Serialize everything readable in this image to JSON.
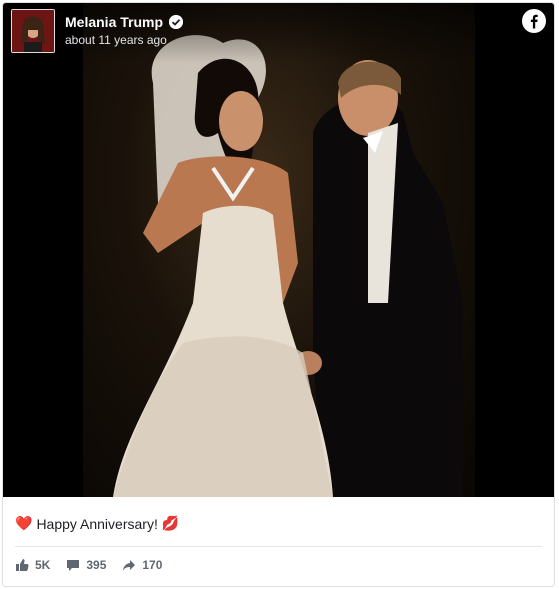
{
  "post": {
    "author": "Melania Trump",
    "timestamp": "about 11 years ago",
    "caption": "Happy Anniversary!",
    "caption_prefix_emoji": "❤️",
    "caption_suffix_emoji": "💋"
  },
  "stats": {
    "likes": "5K",
    "comments": "395",
    "shares": "170"
  },
  "icons": {
    "like": "thumbs-up-icon",
    "comment": "comment-icon",
    "share": "share-icon",
    "verified": "verified-badge-icon",
    "brand": "facebook-logo-icon"
  },
  "colors": {
    "brand": "#1877f2",
    "stat_text": "#606770",
    "caption_text": "#1c1e21"
  }
}
